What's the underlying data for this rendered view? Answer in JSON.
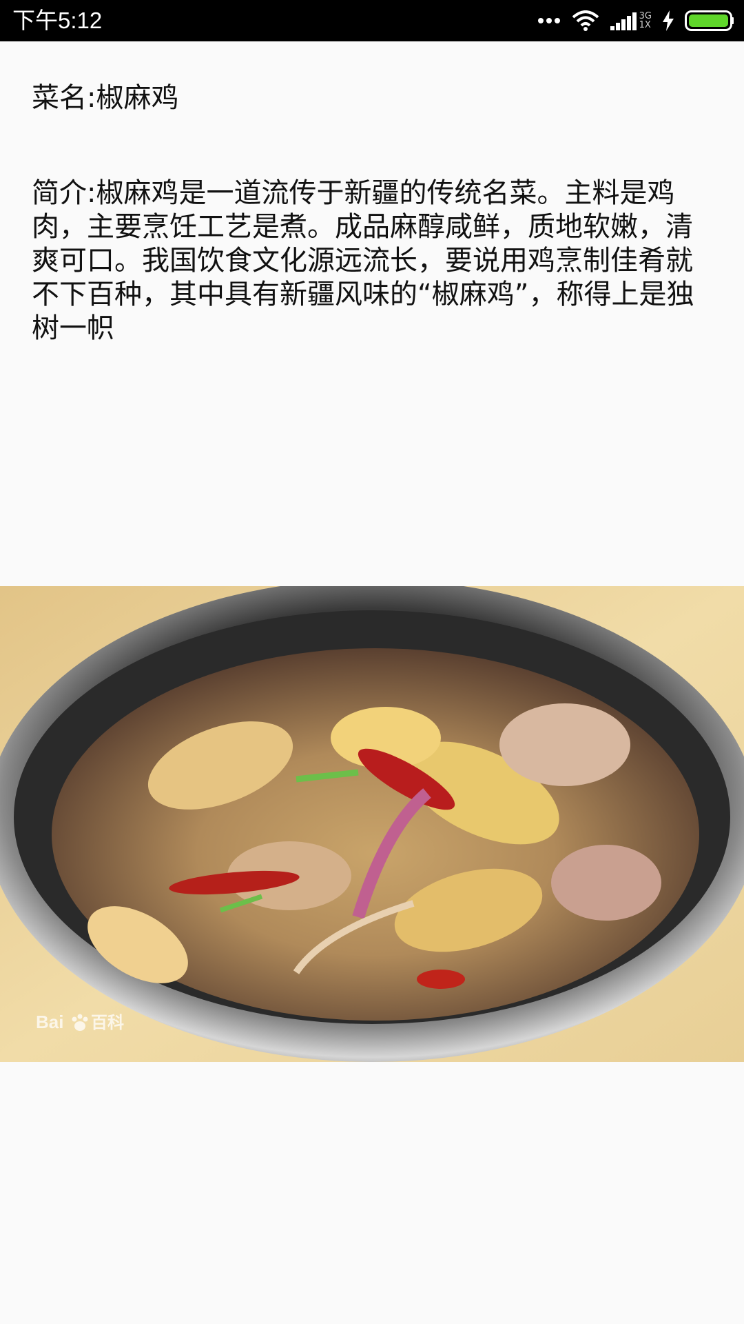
{
  "status_bar": {
    "time": "下午5:12",
    "network_top": "3G",
    "network_bottom": "1X"
  },
  "dish": {
    "name_line": "菜名:椒麻鸡",
    "intro_line": "简介:椒麻鸡是一道流传于新疆的传统名菜。主料是鸡肉，主要烹饪工艺是煮。成品麻醇咸鲜，质地软嫩，清爽可口。我国饮食文化源远流长，要说用鸡烹制佳肴就不下百种，其中具有新疆风味的“椒麻鸡”，称得上是独树一帜",
    "photo_watermark": "Bai百科"
  },
  "colors": {
    "status_bar_bg": "#000000",
    "battery": "#5fd62a",
    "page_bg": "#fafafa",
    "text": "#111111"
  },
  "icons": [
    "more-dots-icon",
    "wifi-icon",
    "signal-icon",
    "charging-icon",
    "battery-icon"
  ]
}
